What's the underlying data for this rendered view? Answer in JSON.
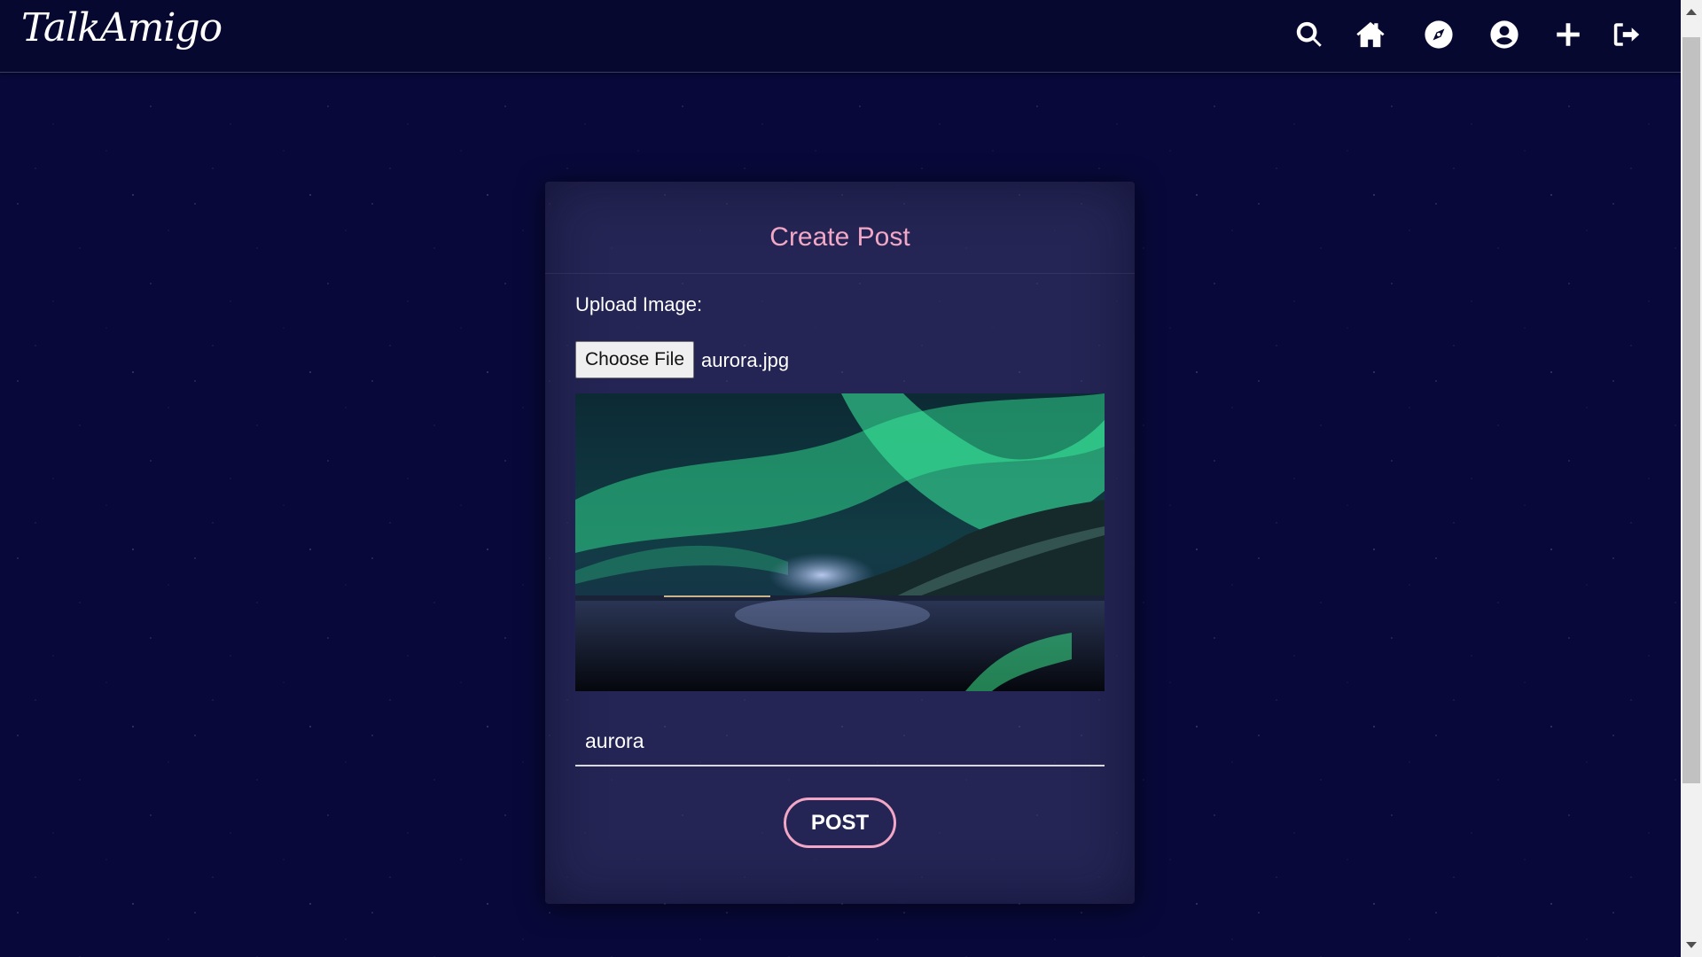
{
  "app": {
    "brand": "TalkAmigo"
  },
  "nav": {
    "icons": [
      "search-icon",
      "home-icon",
      "compass-icon",
      "user-circle-icon",
      "plus-icon",
      "logout-icon"
    ]
  },
  "card": {
    "title": "Create Post",
    "upload_label": "Upload Image:",
    "choose_file_label": "Choose File",
    "file_name": "aurora.jpg",
    "caption_value": "aurora",
    "post_button_label": "POST"
  },
  "colors": {
    "background": "#08093a",
    "navbar": "#07082f",
    "accent_pink": "#f3a7c6"
  }
}
